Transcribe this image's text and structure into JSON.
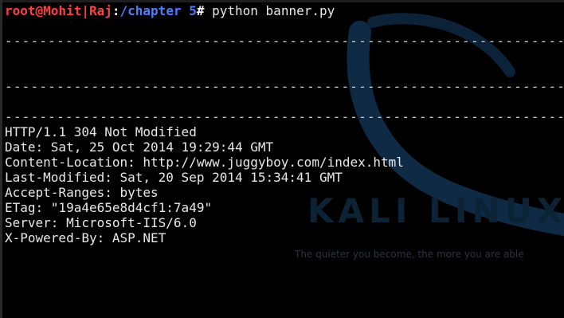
{
  "prompt": {
    "user": "root@Mohit",
    "sep": "|",
    "host": "Raj",
    "colon": ":",
    "path": "/chapter 5",
    "hash": "#",
    "command": " python banner.py"
  },
  "separator": "-----------------------------------------------------------------------------",
  "response_lines": [
    "HTTP/1.1 304 Not Modified",
    "Date: Sat, 25 Oct 2014 19:29:44 GMT",
    "Content-Location: http://www.juggyboy.com/index.html",
    "Last-Modified: Sat, 20 Sep 2014 15:34:41 GMT",
    "Accept-Ranges: bytes",
    "ETag: \"19a4e65e8d4cf1:7a49\"",
    "Server: Microsoft-IIS/6.0",
    "X-Powered-By: ASP.NET"
  ],
  "wallpaper": {
    "watermark": "KALI LINUX",
    "tagline": "The quieter you become, the more you are able"
  },
  "colors": {
    "prompt_user": "#ff4040",
    "prompt_path": "#4f7dff",
    "text": "#e8e8e8",
    "background": "#000000"
  },
  "icons": [
    "unprintable-glyph-icon",
    "kali-dragon-icon"
  ]
}
